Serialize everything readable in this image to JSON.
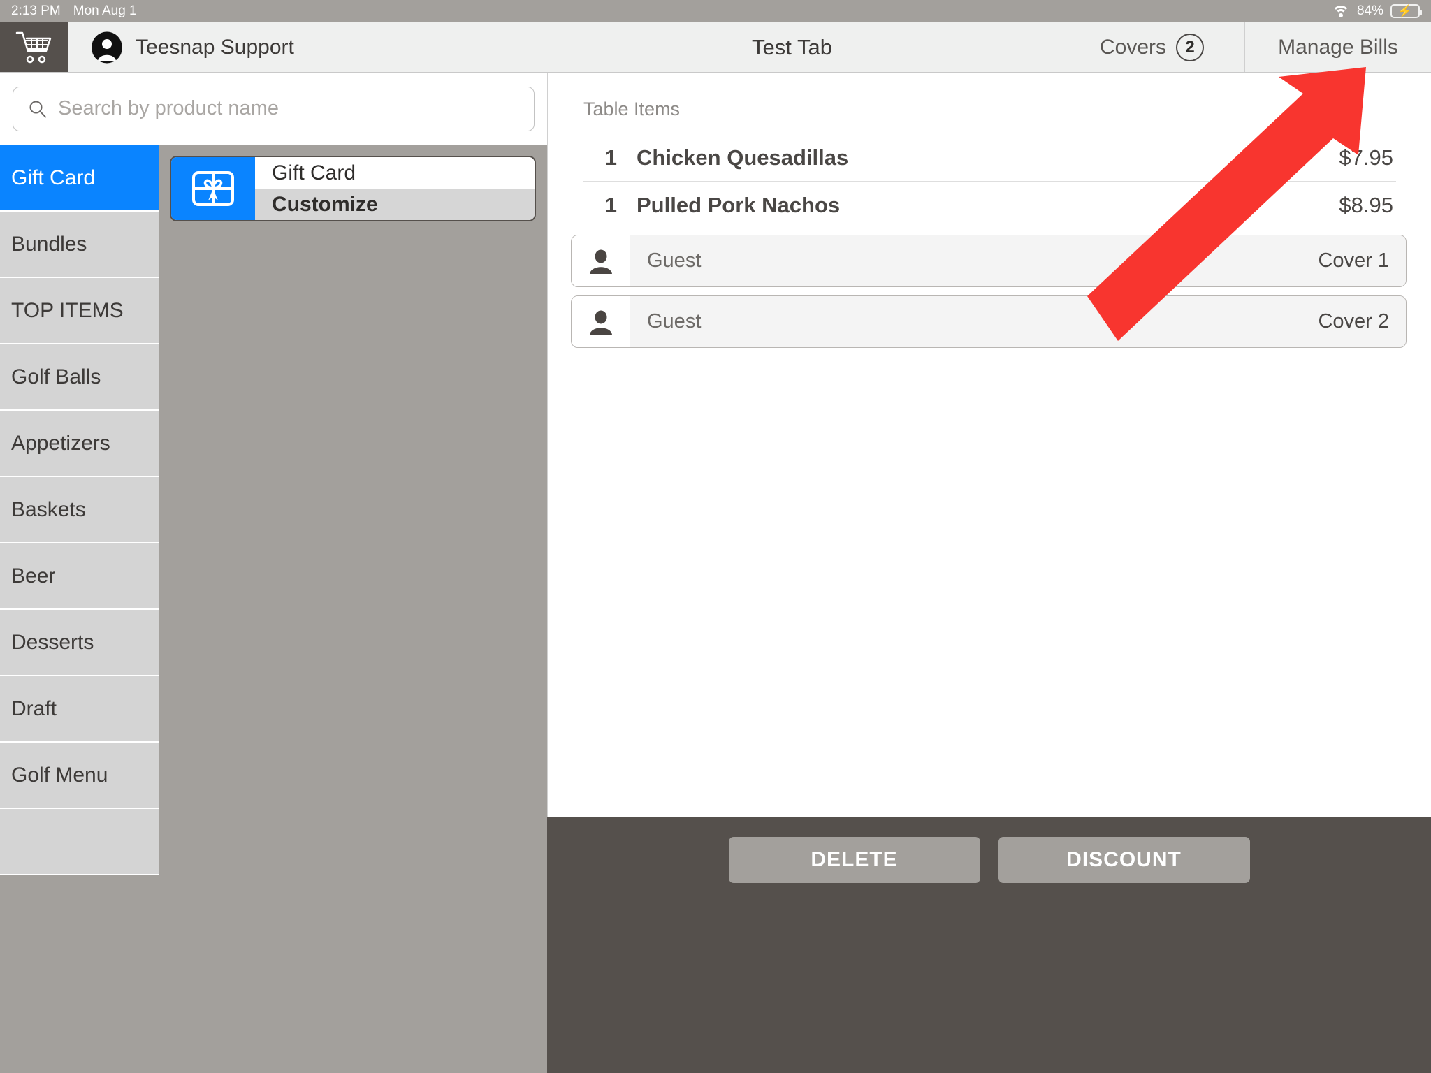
{
  "statusbar": {
    "time": "2:13 PM",
    "date": "Mon Aug 1",
    "battery_percent": "84%",
    "wifi_icon": "wifi-icon",
    "battery_icon": "battery-charging-icon"
  },
  "topbar": {
    "cart_icon": "shopping-cart-icon",
    "avatar_icon": "user-avatar-icon",
    "user_name": "Teesnap Support",
    "tab_name": "Test Tab",
    "covers_label": "Covers",
    "covers_count": "2",
    "manage_bills_label": "Manage Bills"
  },
  "search": {
    "placeholder": "Search by product name",
    "value": "",
    "icon": "search-icon"
  },
  "categories": [
    {
      "label": "Gift Card",
      "selected": true
    },
    {
      "label": "Bundles",
      "selected": false
    },
    {
      "label": "TOP ITEMS",
      "selected": false
    },
    {
      "label": "Golf Balls",
      "selected": false
    },
    {
      "label": "Appetizers",
      "selected": false
    },
    {
      "label": "Baskets",
      "selected": false
    },
    {
      "label": "Beer",
      "selected": false
    },
    {
      "label": "Desserts",
      "selected": false
    },
    {
      "label": "Draft",
      "selected": false
    },
    {
      "label": "Golf Menu",
      "selected": false
    },
    {
      "label": "",
      "selected": false
    }
  ],
  "products": [
    {
      "name": "Gift Card",
      "action_label": "Customize",
      "icon": "gift-card-icon"
    }
  ],
  "order": {
    "section_title": "Table Items",
    "items": [
      {
        "qty": "1",
        "name": "Chicken Quesadillas",
        "price": "$7.95"
      },
      {
        "qty": "1",
        "name": "Pulled Pork Nachos",
        "price": "$8.95"
      }
    ],
    "covers": [
      {
        "guest": "Guest",
        "cover": "Cover 1",
        "icon": "person-icon"
      },
      {
        "guest": "Guest",
        "cover": "Cover 2",
        "icon": "person-icon"
      }
    ]
  },
  "actions": {
    "delete_label": "DELETE",
    "discount_label": "DISCOUNT"
  },
  "colors": {
    "accent_blue": "#0a84ff",
    "chrome_grey": "#a3a09c",
    "dark_bar": "#55504c",
    "annotation_red": "#f8352f",
    "battery_green": "#4cd964"
  },
  "annotation": {
    "type": "arrow",
    "points_to": "Manage Bills"
  }
}
